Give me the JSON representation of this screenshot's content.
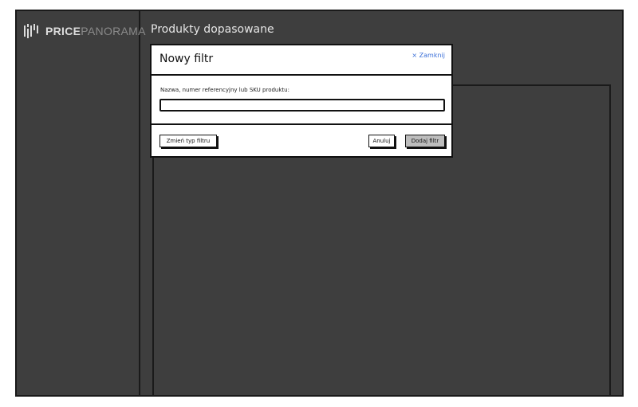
{
  "brand": {
    "name_strong": "PRICE",
    "name_light": "PANORAMA"
  },
  "page": {
    "title": "Produkty dopasowane"
  },
  "modal": {
    "title": "Nowy filtr",
    "close_label": "× Zamknij",
    "field_label": "Nazwa, numer referencyjny lub SKU produktu:",
    "field_value": "",
    "change_type_label": "Zmień typ filtru",
    "cancel_label": "Anuluj",
    "add_label": "Dodaj filtr"
  },
  "colors": {
    "background": "#3e3e3e",
    "link": "#3a6fd8",
    "primary_button": "#bdbdbd"
  }
}
